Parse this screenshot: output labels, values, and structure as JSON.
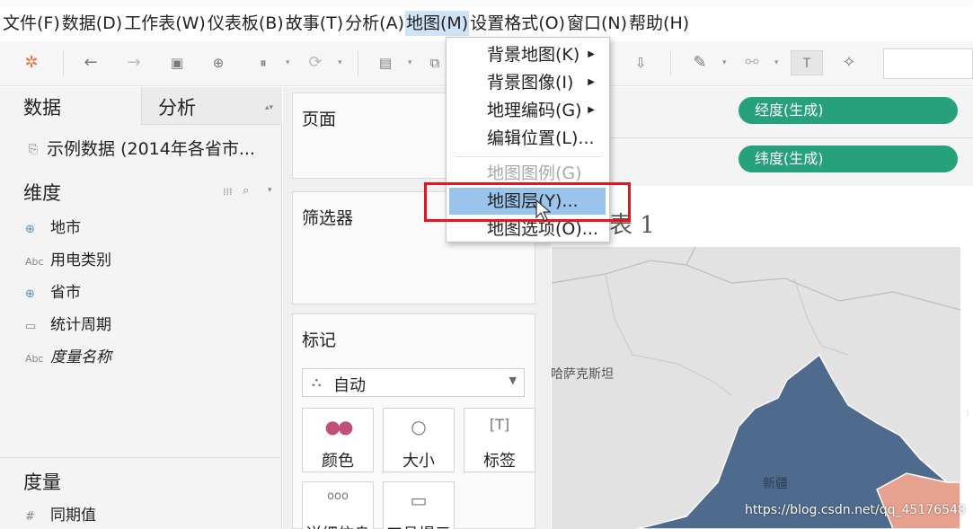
{
  "menubar": {
    "items": [
      "文件(F)",
      "数据(D)",
      "工作表(W)",
      "仪表板(B)",
      "故事(T)",
      "分析(A)",
      "地图(M)",
      "设置格式(O)",
      "窗口(N)",
      "帮助(H)"
    ],
    "active_index": 6
  },
  "map_menu": {
    "items": [
      {
        "label": "背景地图(K)",
        "submenu": true,
        "enabled": true
      },
      {
        "label": "背景图像(I)",
        "submenu": true,
        "enabled": true
      },
      {
        "label": "地理编码(G)",
        "submenu": true,
        "enabled": true
      },
      {
        "label": "编辑位置(L)...",
        "submenu": false,
        "enabled": true
      },
      {
        "label": "地图图例(G)",
        "submenu": false,
        "enabled": false
      },
      {
        "label": "地图层(Y)...",
        "submenu": false,
        "enabled": true,
        "hovered": true
      },
      {
        "label": "地图选项(O)...",
        "submenu": false,
        "enabled": true
      }
    ],
    "highlight_color": "#e4161b"
  },
  "data_pane": {
    "tabs": [
      "数据",
      "分析"
    ],
    "datasource": "示例数据 (2014年各省市...",
    "dimensions_title": "维度",
    "dimensions": [
      {
        "name": "地市",
        "icon": "globe-icon"
      },
      {
        "name": "用电类别",
        "icon": "abc-icon"
      },
      {
        "name": "省市",
        "icon": "globe-icon"
      },
      {
        "name": "统计周期",
        "icon": "calendar-icon"
      },
      {
        "name": "度量名称",
        "icon": "abc-icon"
      }
    ],
    "measures_title": "度量",
    "measures": [
      {
        "name": "同期值",
        "icon": "hash-icon"
      }
    ]
  },
  "shelves": {
    "pages": "页面",
    "filters": "筛选器",
    "marks": "标记",
    "marks_type": "自动",
    "mark_buttons": [
      "颜色",
      "大小",
      "标签",
      "详细信息",
      "工具提示"
    ]
  },
  "columns_pill": "经度(生成)",
  "rows_pill": "纬度(生成)",
  "sheet_title": "表 1",
  "map": {
    "labels": [
      "哈萨克斯坦",
      "新疆"
    ],
    "colors": {
      "land": "#e2e2e2",
      "region": "#4e6a8c",
      "other": "#e7a28f"
    }
  },
  "watermark": "https://blog.csdn.net/qq_45176548"
}
